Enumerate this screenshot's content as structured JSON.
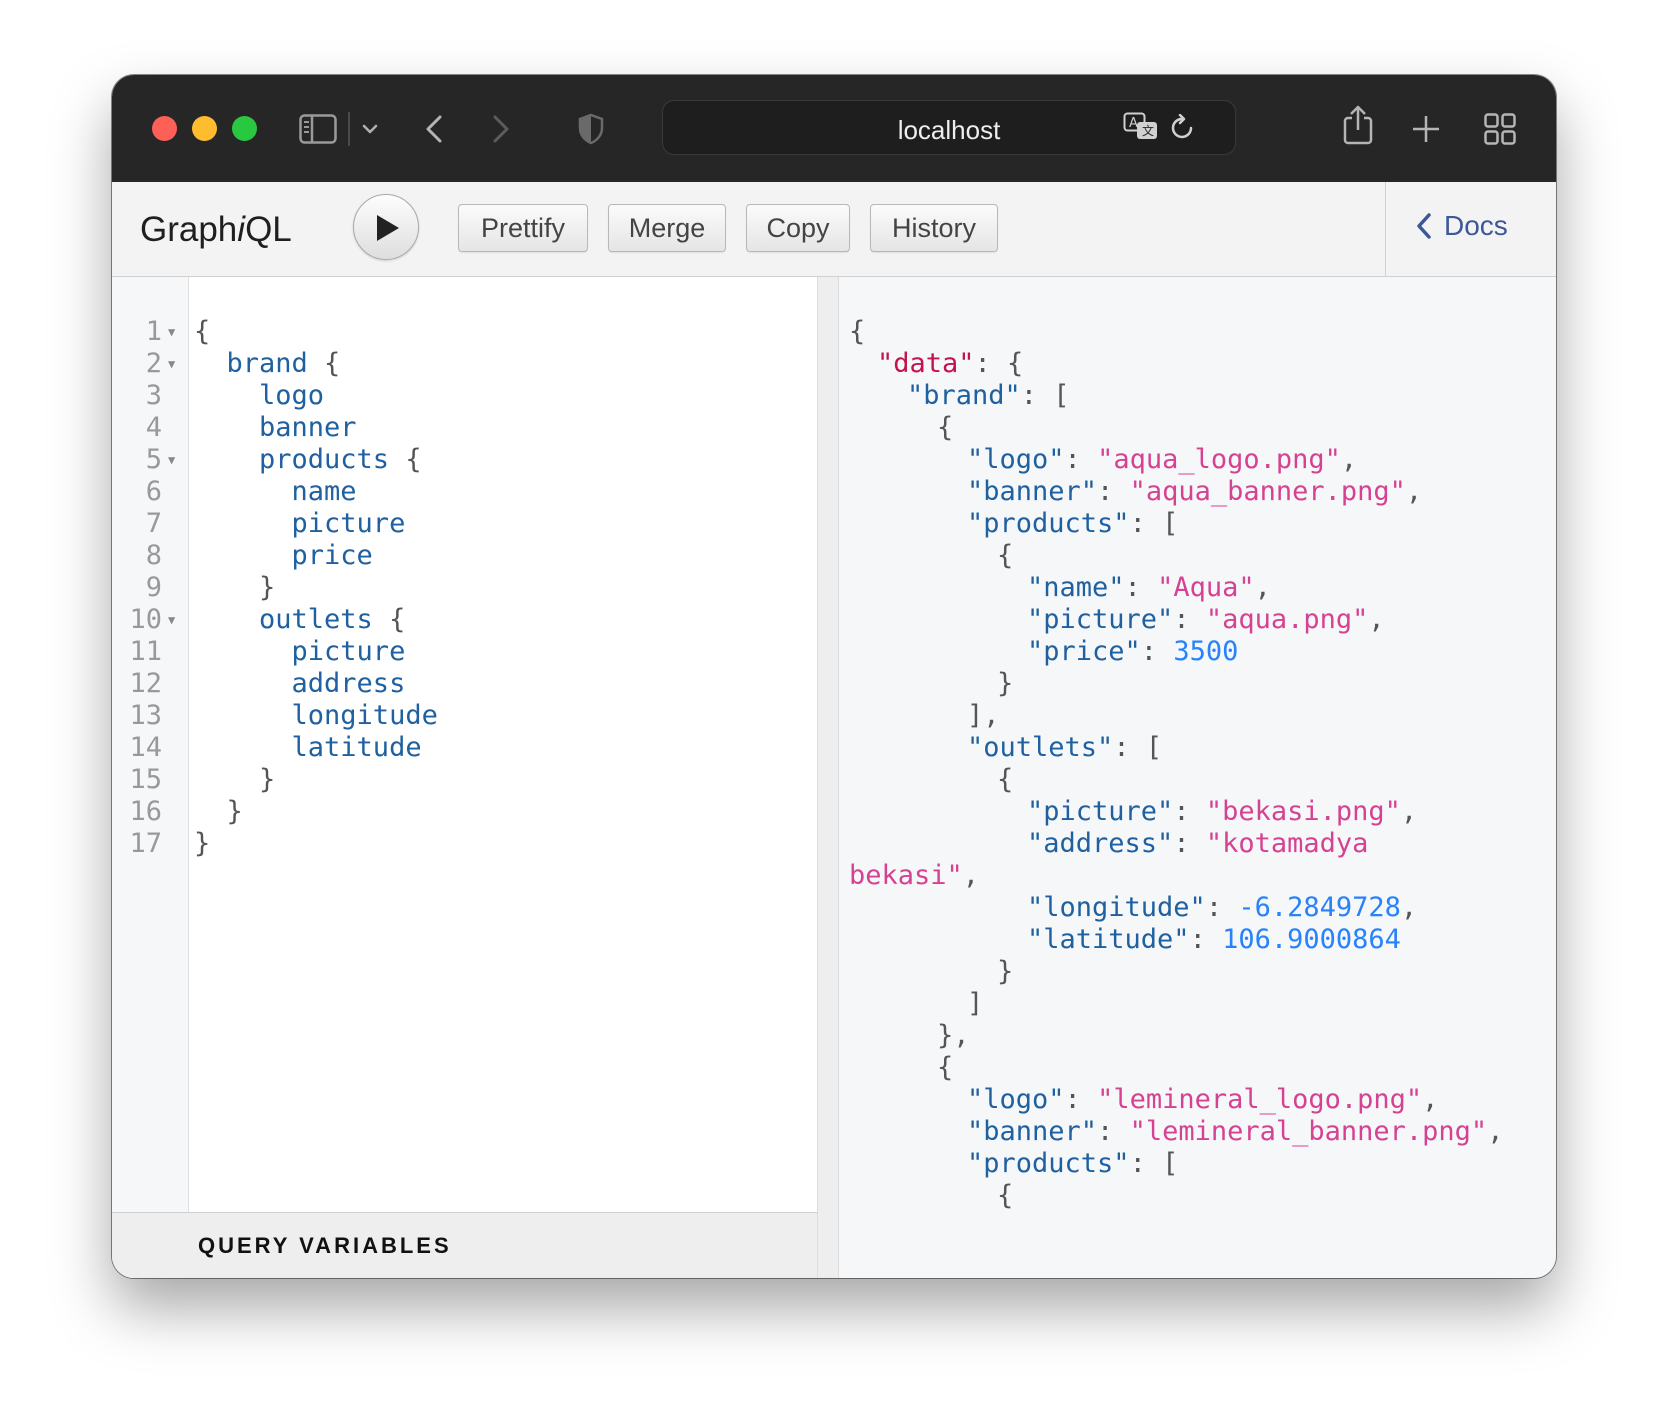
{
  "browser": {
    "url": "localhost"
  },
  "toolbar": {
    "logo_prefix": "Graph",
    "logo_i": "i",
    "logo_suffix": "QL",
    "buttons": [
      "Prettify",
      "Merge",
      "Copy",
      "History"
    ],
    "docs_label": "Docs"
  },
  "query": {
    "line_numbers": [
      "1",
      "2",
      "3",
      "4",
      "5",
      "6",
      "7",
      "8",
      "9",
      "10",
      "11",
      "12",
      "13",
      "14",
      "15",
      "16",
      "17"
    ],
    "lines": [
      "{",
      "  brand {",
      "    logo",
      "    banner",
      "    products {",
      "      name",
      "      picture",
      "      price",
      "    }",
      "    outlets {",
      "      picture",
      "      address",
      "      longitude",
      "      latitude",
      "    }",
      "  }",
      "}"
    ]
  },
  "query_variables_label": "QUERY VARIABLES",
  "result": {
    "data_key": "\"data\"",
    "brand_key": "\"brand\"",
    "item1": {
      "logo_key": "\"logo\"",
      "logo": "\"aqua_logo.png\"",
      "banner_key": "\"banner\"",
      "banner": "\"aqua_banner.png\"",
      "products_key": "\"products\"",
      "name_key": "\"name\"",
      "name": "\"Aqua\"",
      "picture_key": "\"picture\"",
      "picture": "\"aqua.png\"",
      "price_key": "\"price\"",
      "price": "3500",
      "outlets_key": "\"outlets\"",
      "outlet_picture": "\"bekasi.png\"",
      "address_key": "\"address\"",
      "address_part1": "\"kotamadya",
      "address_part2": "bekasi\"",
      "longitude_key": "\"longitude\"",
      "longitude": "-6.2849728",
      "latitude_key": "\"latitude\"",
      "latitude": "106.9000864"
    },
    "item2": {
      "logo": "\"lemineral_logo.png\"",
      "banner": "\"lemineral_banner.png\""
    }
  }
}
